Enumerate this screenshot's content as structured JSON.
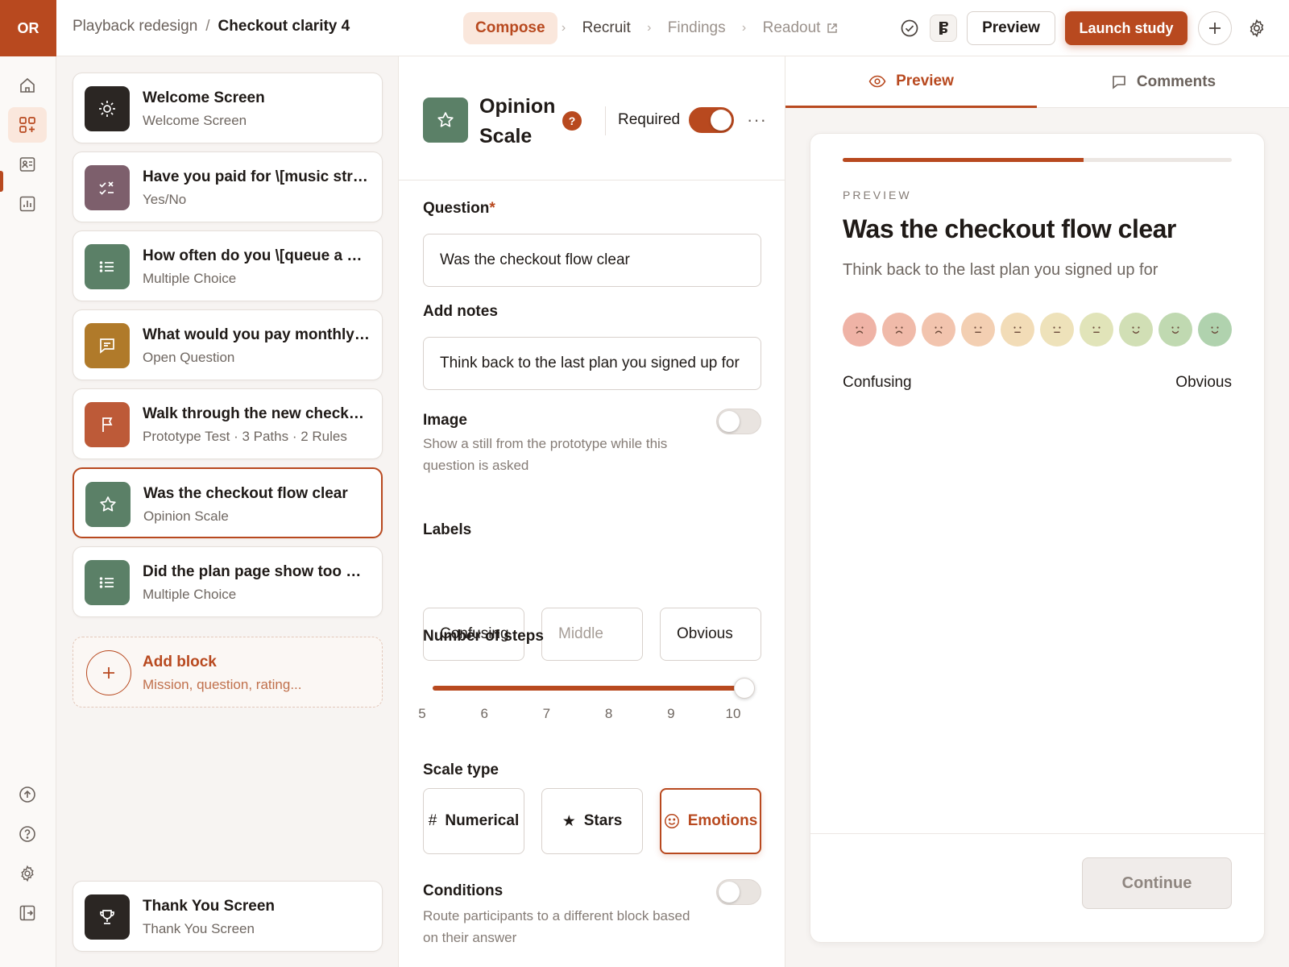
{
  "app": {
    "logo": "OR"
  },
  "breadcrumb": {
    "parent": "Playback redesign",
    "separator": "/",
    "current": "Checkout clarity 4"
  },
  "steps": [
    {
      "label": "Compose"
    },
    {
      "label": "Recruit"
    },
    {
      "label": "Findings"
    },
    {
      "label": "Readout"
    }
  ],
  "topbar": {
    "preview_label": "Preview",
    "launch_label": "Launch study"
  },
  "blocks": [
    {
      "title": "Welcome Screen",
      "subtitle": "Welcome Screen",
      "icon": "sun-icon",
      "color": "#2b2623"
    },
    {
      "title": "Have you paid for \\[music stre...",
      "subtitle": "Yes/No",
      "icon": "check-x-icon",
      "color": "#7d5f6c"
    },
    {
      "title": "How often do you \\[queue a pl...",
      "subtitle": "Multiple Choice",
      "icon": "list-icon",
      "color": "#5b8067"
    },
    {
      "title": "What would you pay monthly f...",
      "subtitle": "Open Question",
      "icon": "message-icon",
      "color": "#b07a2a"
    },
    {
      "title": "Walk through the new checkout",
      "subtitle": "Prototype Test · 3 Paths · 2 Rules",
      "icon": "flag-icon",
      "color": "#bd5a38"
    },
    {
      "title": "Was the checkout flow clear",
      "subtitle": "Opinion Scale",
      "icon": "star-icon",
      "color": "#5b8067"
    },
    {
      "title": "Did the plan page show too m...",
      "subtitle": "Multiple Choice",
      "icon": "list-icon",
      "color": "#5b8067"
    }
  ],
  "add_block": {
    "title": "Add block",
    "subtitle": "Mission, question, rating..."
  },
  "thank_you": {
    "title": "Thank You Screen",
    "subtitle": "Thank You Screen",
    "icon": "trophy-icon"
  },
  "editor": {
    "title": "Opinion Scale",
    "help": "?",
    "required_label": "Required",
    "required_on": true,
    "more": "···",
    "question_label": "Question",
    "question_star": "*",
    "question_value": "Was the checkout flow clear",
    "notes_label": "Add notes",
    "notes_value": "Think back to the last plan you signed up for",
    "image_label": "Image",
    "image_desc": "Show a still from the prototype while this question is asked",
    "image_on": false,
    "labels_label": "Labels",
    "label_low": "Confusing",
    "label_mid_placeholder": "Middle",
    "label_high": "Obvious",
    "steps_label": "Number of steps",
    "steps_ticks": [
      "5",
      "6",
      "7",
      "8",
      "9",
      "10"
    ],
    "steps_value": 10,
    "scale_type_label": "Scale type",
    "scale_types": [
      {
        "label": "Numerical",
        "icon": "hash-icon",
        "glyph": "#"
      },
      {
        "label": "Stars",
        "icon": "star-filled-icon",
        "glyph": "★"
      },
      {
        "label": "Emotions",
        "icon": "smiley-icon",
        "glyph": ""
      }
    ],
    "scale_type_selected": "Emotions",
    "conditions_label": "Conditions",
    "conditions_desc": "Route participants to a different block based on their answer",
    "conditions_on": false
  },
  "preview": {
    "tab_preview": "Preview",
    "tab_comments": "Comments",
    "progress": 0.62,
    "eyebrow": "PREVIEW",
    "title": "Was the checkout flow clear",
    "desc": "Think back to the last plan you signed up for",
    "low_label": "Confusing",
    "high_label": "Obvious",
    "face_colors": [
      "#efb3a6",
      "#f0baa9",
      "#f2c4ae",
      "#f3cfb2",
      "#f2dcb7",
      "#eee2ba",
      "#e1e4b9",
      "#d1dfb5",
      "#c0d9b1",
      "#b0d2ae"
    ],
    "face_moods": [
      "sad",
      "sad",
      "sad",
      "neutral",
      "neutral",
      "neutral",
      "neutral",
      "happy",
      "happy",
      "happy"
    ],
    "continue_label": "Continue"
  }
}
